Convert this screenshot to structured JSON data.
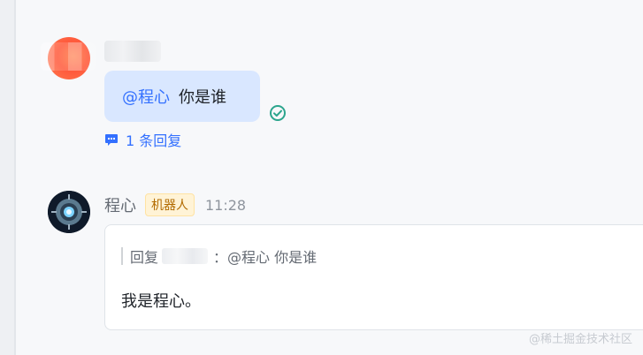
{
  "thread": {
    "user_message": {
      "mention": "@程心",
      "text": "你是谁",
      "reply_icon": "reply-thread-icon",
      "reply_count_text": "1 条回复",
      "read_status_icon": "check-circle-icon"
    },
    "bot_message": {
      "name": "程心",
      "tag": "机器人",
      "time": "11:28",
      "quote_prefix": "回复",
      "quote_colon": "：",
      "quote_text": "@程心 你是谁",
      "answer": "我是程心。"
    }
  },
  "watermark": "@稀土掘金技术社区",
  "colors": {
    "accent": "#3370ff",
    "bubble": "#d9e7ff",
    "bot_tag_bg": "#fff3d6",
    "bot_tag_text": "#b26b00",
    "check_green": "#2ca58d"
  }
}
